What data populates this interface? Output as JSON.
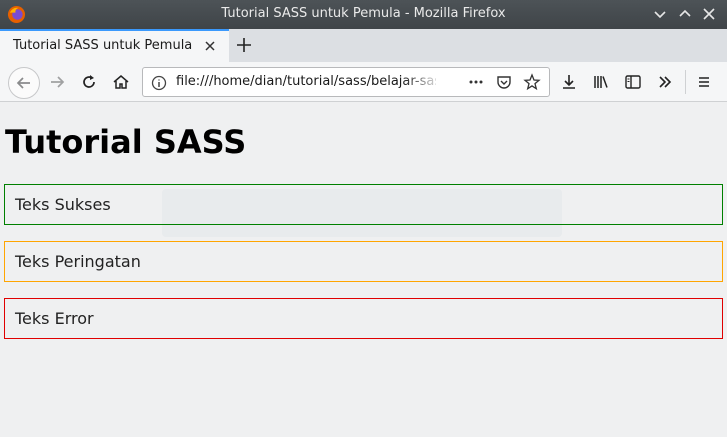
{
  "window": {
    "title": "Tutorial SASS untuk Pemula - Mozilla Firefox"
  },
  "tabs": [
    {
      "label": "Tutorial SASS untuk Pemula",
      "active": true
    }
  ],
  "navbar": {
    "url": "file:///home/dian/tutorial/sass/belajar-sass"
  },
  "page": {
    "heading": "Tutorial SASS",
    "boxes": [
      {
        "label": "Teks Sukses",
        "color": "#008000"
      },
      {
        "label": "Teks Peringatan",
        "color": "#ffa500"
      },
      {
        "label": "Teks Error",
        "color": "#e00000"
      }
    ]
  },
  "colors": {
    "titlebar": "#474c50",
    "tab_accent": "#3b99fc",
    "page_bg": "#eff0f1"
  }
}
